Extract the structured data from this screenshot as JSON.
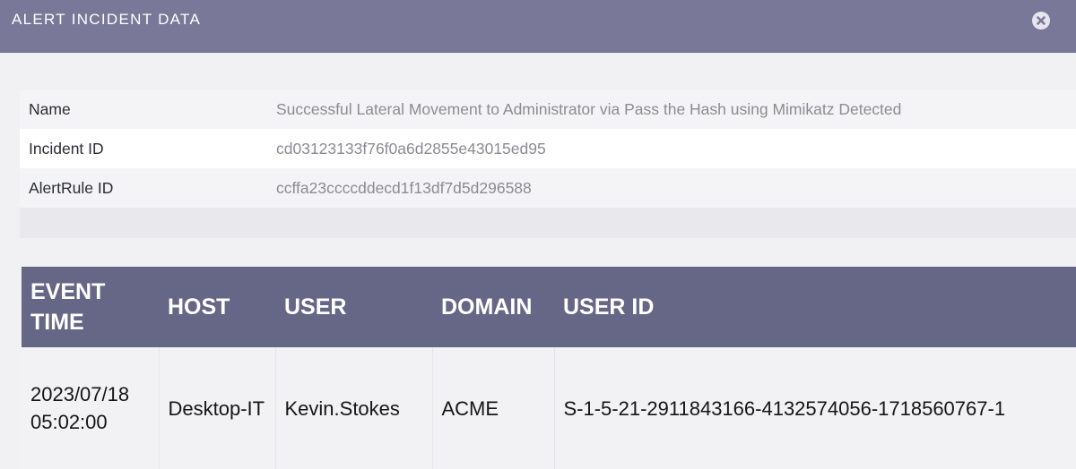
{
  "dialog": {
    "title": "ALERT INCIDENT DATA",
    "close_icon": "close-icon"
  },
  "info": {
    "rows": [
      {
        "label": "Name",
        "value": "Successful Lateral Movement to Administrator via Pass the Hash using Mimikatz Detected"
      },
      {
        "label": "Incident ID",
        "value": "cd03123133f76f0a6d2855e43015ed95"
      },
      {
        "label": "AlertRule ID",
        "value": "ccffa23ccccddecd1f13df7d5d296588"
      }
    ]
  },
  "events": {
    "columns": [
      "EVENT TIME",
      "HOST",
      "USER",
      "DOMAIN",
      "USER ID"
    ],
    "rows": [
      {
        "event_time": "2023/07/18 05:02:00",
        "host": "Desktop-IT",
        "user": "Kevin.Stokes",
        "domain": "ACME",
        "user_id": "S-1-5-21-2911843166-4132574056-1718560767-1"
      }
    ]
  },
  "colors": {
    "title_bar": "#7a7898",
    "table_header": "#666686",
    "background": "#f1f1f3"
  }
}
